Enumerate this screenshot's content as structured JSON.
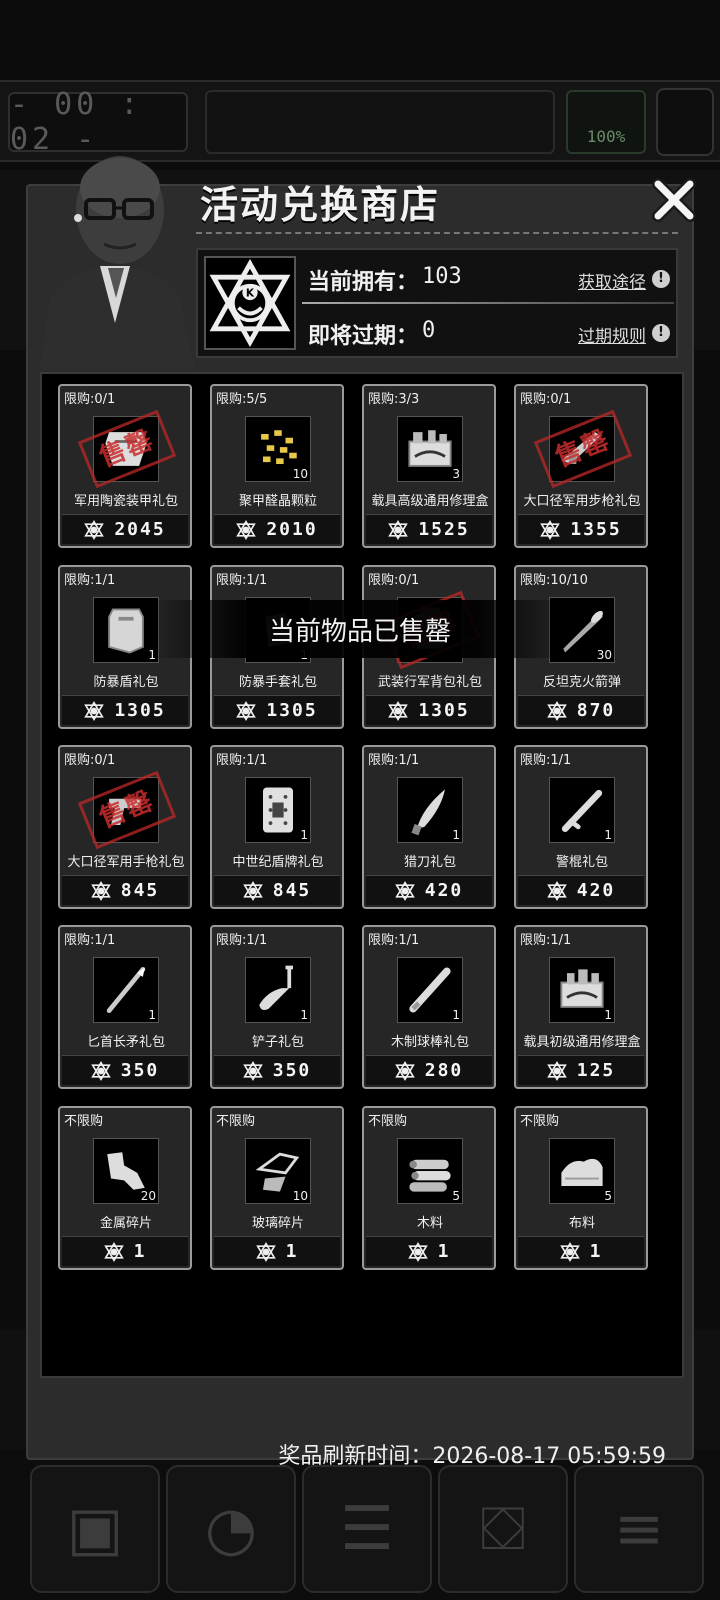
{
  "background": {
    "timer": "- 00 : 02 -",
    "percent": "100%"
  },
  "shop": {
    "title": "活动兑换商店",
    "owned_label": "当前拥有：",
    "owned_value": "103",
    "obtain_link": "获取途径",
    "expiring_label": "即将过期：",
    "expiring_value": "0",
    "expire_rules_link": "过期规则",
    "refresh_label": "奖品刷新时间：",
    "refresh_time": "2026-08-17 05:59:59",
    "toast": "当前物品已售罄",
    "help_glyph": "!"
  },
  "items": [
    {
      "limit": "限购:0/1",
      "name": "军用陶瓷装甲礼包",
      "price": "2045",
      "qty": "",
      "icon": "armor-gift-icon",
      "sold_out": true
    },
    {
      "limit": "限购:5/5",
      "name": "聚甲醛晶颗粒",
      "price": "2010",
      "qty": "10",
      "icon": "granules-icon",
      "sold_out": false
    },
    {
      "limit": "限购:3/3",
      "name": "载具高级通用修理盒",
      "price": "1525",
      "qty": "3",
      "icon": "advanced-repair-kit-icon",
      "sold_out": false
    },
    {
      "limit": "限购:0/1",
      "name": "大口径军用步枪礼包",
      "price": "1355",
      "qty": "",
      "icon": "rifle-gift-icon",
      "sold_out": true
    },
    {
      "limit": "限购:1/1",
      "name": "防暴盾礼包",
      "price": "1305",
      "qty": "1",
      "icon": "riot-shield-icon",
      "sold_out": false
    },
    {
      "limit": "限购:1/1",
      "name": "防暴手套礼包",
      "price": "1305",
      "qty": "1",
      "icon": "riot-gloves-icon",
      "sold_out": false
    },
    {
      "limit": "限购:0/1",
      "name": "武装行军背包礼包",
      "price": "1305",
      "qty": "",
      "icon": "backpack-gift-icon",
      "sold_out": true
    },
    {
      "limit": "限购:10/10",
      "name": "反坦克火箭弹",
      "price": "870",
      "qty": "30",
      "icon": "rocket-icon",
      "sold_out": false
    },
    {
      "limit": "限购:0/1",
      "name": "大口径军用手枪礼包",
      "price": "845",
      "qty": "",
      "icon": "pistol-gift-icon",
      "sold_out": true
    },
    {
      "limit": "限购:1/1",
      "name": "中世纪盾牌礼包",
      "price": "845",
      "qty": "1",
      "icon": "medieval-shield-icon",
      "sold_out": false
    },
    {
      "limit": "限购:1/1",
      "name": "猎刀礼包",
      "price": "420",
      "qty": "1",
      "icon": "hunting-knife-icon",
      "sold_out": false
    },
    {
      "limit": "限购:1/1",
      "name": "警棍礼包",
      "price": "420",
      "qty": "1",
      "icon": "baton-icon",
      "sold_out": false
    },
    {
      "limit": "限购:1/1",
      "name": "匕首长矛礼包",
      "price": "350",
      "qty": "1",
      "icon": "dagger-spear-icon",
      "sold_out": false
    },
    {
      "limit": "限购:1/1",
      "name": "铲子礼包",
      "price": "350",
      "qty": "1",
      "icon": "shovel-icon",
      "sold_out": false
    },
    {
      "limit": "限购:1/1",
      "name": "木制球棒礼包",
      "price": "280",
      "qty": "1",
      "icon": "wooden-bat-icon",
      "sold_out": false
    },
    {
      "limit": "限购:1/1",
      "name": "载具初级通用修理盒",
      "price": "125",
      "qty": "1",
      "icon": "basic-repair-kit-icon",
      "sold_out": false
    },
    {
      "limit": "不限购",
      "name": "金属碎片",
      "price": "1",
      "qty": "20",
      "icon": "metal-scrap-icon",
      "sold_out": false
    },
    {
      "limit": "不限购",
      "name": "玻璃碎片",
      "price": "1",
      "qty": "10",
      "icon": "glass-shards-icon",
      "sold_out": false
    },
    {
      "limit": "不限购",
      "name": "木料",
      "price": "1",
      "qty": "5",
      "icon": "wood-logs-icon",
      "sold_out": false
    },
    {
      "limit": "不限购",
      "name": "布料",
      "price": "1",
      "qty": "5",
      "icon": "cloth-icon",
      "sold_out": false
    }
  ],
  "sold_out_stamp": "售罄",
  "nav": [
    {
      "icon": "backpack-icon"
    },
    {
      "icon": "brain-icon"
    },
    {
      "icon": "journal-icon"
    },
    {
      "icon": "shopping-cart-icon"
    },
    {
      "icon": "menu-icon"
    }
  ]
}
